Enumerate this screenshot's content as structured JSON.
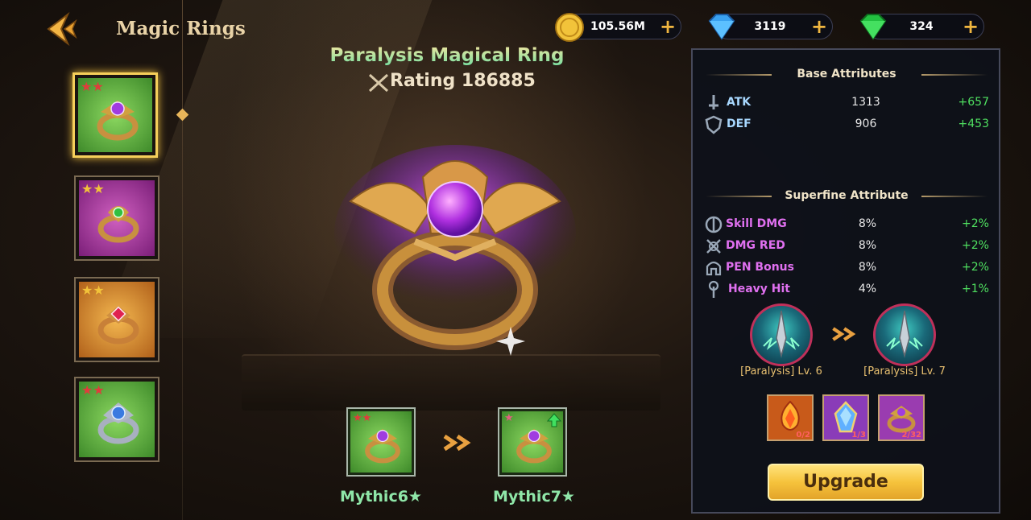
{
  "header": {
    "title": "Magic Rings",
    "back_icon": "back-arrow-icon"
  },
  "currencies": [
    {
      "name": "gold-coin",
      "icon": "gold-coin-icon",
      "value": "105.56M",
      "color": "#f2c33a"
    },
    {
      "name": "diamond",
      "icon": "blue-diamond-icon",
      "value": "3119",
      "color": "#3aa2f0"
    },
    {
      "name": "emerald",
      "icon": "green-gem-icon",
      "value": "324",
      "color": "#22c040"
    }
  ],
  "ring_list": [
    {
      "stars": "★★",
      "star_color": "#e03c3c",
      "bg": "#5eb84a",
      "gem": "#a03ce0",
      "selected": true
    },
    {
      "stars": "★★",
      "star_color": "#f2c33a",
      "bg": "#a83c9c",
      "gem": "#30c040",
      "selected": false
    },
    {
      "stars": "★★",
      "star_color": "#f2c33a",
      "bg": "#e0902a",
      "gem": "#e02050",
      "selected": false
    },
    {
      "stars": "★★",
      "star_color": "#e03c3c",
      "bg": "#5eb84a",
      "gem": "#3a7ae0",
      "selected": false
    }
  ],
  "item": {
    "name": "Paralysis Magical Ring",
    "rating_label": "Rating 186885",
    "rating_icon": "crossed-swords-icon"
  },
  "evolution": {
    "from_label": "Mythic6★",
    "to_label": "Mythic7★",
    "arrow_icon": "double-chevron-right-icon"
  },
  "base_attributes": {
    "title": "Base Attributes",
    "rows": [
      {
        "icon": "sword-icon",
        "name": "ATK",
        "value": "1313",
        "increase": "+657",
        "color": "#a8d8ff"
      },
      {
        "icon": "shield-icon",
        "name": "DEF",
        "value": "906",
        "increase": "+453",
        "color": "#a8d8ff"
      }
    ]
  },
  "superfine_attributes": {
    "title": "Superfine Attribute",
    "rows": [
      {
        "icon": "skill-dmg-icon",
        "name": "Skill DMG",
        "value": "8%",
        "increase": "+2%",
        "color": "#e070f0"
      },
      {
        "icon": "dmg-red-icon",
        "name": "DMG RED",
        "value": "8%",
        "increase": "+2%",
        "color": "#e070f0"
      },
      {
        "icon": "helmet-icon",
        "name": "PEN Bonus",
        "value": "8%",
        "increase": "+2%",
        "color": "#e070f0"
      },
      {
        "icon": "heavy-hit-icon",
        "name": "Heavy Hit",
        "value": "4%",
        "increase": "+1%",
        "color": "#e070f0"
      }
    ]
  },
  "skill": {
    "from_label": "[Paralysis] Lv. 6",
    "to_label": "[Paralysis] Lv. 7",
    "arrow_icon": "double-chevron-right-icon"
  },
  "materials": [
    {
      "icon": "fire-crystal-icon",
      "count": "0/2",
      "bg": "#c85a1a"
    },
    {
      "icon": "blue-crystal-icon",
      "count": "1/3",
      "bg": "#8a3cb8"
    },
    {
      "icon": "ring-material-icon",
      "count": "2/32",
      "bg": "#9a3cb0"
    }
  ],
  "upgrade_button": "Upgrade"
}
